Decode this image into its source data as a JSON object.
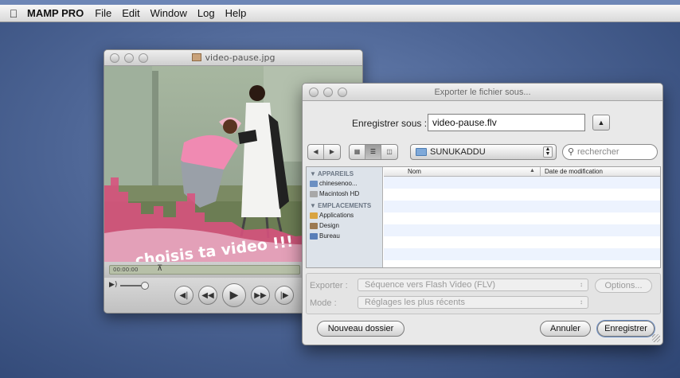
{
  "menubar": {
    "app_name": "MAMP PRO",
    "menus": [
      "File",
      "Edit",
      "Window",
      "Log",
      "Help"
    ]
  },
  "quicktime": {
    "title": "video-pause.jpg",
    "overlay_text": "choisis ta video !!!",
    "timecode": "00:00:00"
  },
  "dialog": {
    "title": "Exporter le fichier sous...",
    "save_as_label": "Enregistrer sous :",
    "filename": "video-pause.flv",
    "folder": "SUNUKADDU",
    "search_placeholder": "rechercher",
    "sidebar": {
      "devices_header": "APPAREILS",
      "devices": [
        "chinesenoo...",
        "Macintosh HD"
      ],
      "places_header": "EMPLACEMENTS",
      "places": [
        "Applications",
        "Design",
        "Bureau"
      ]
    },
    "columns": {
      "name": "Nom",
      "date": "Date de modification"
    },
    "export_label": "Exporter :",
    "export_value": "Séquence vers Flash Video (FLV)",
    "options_label": "Options...",
    "mode_label": "Mode :",
    "mode_value": "Réglages les plus récents",
    "new_folder_label": "Nouveau dossier",
    "cancel_label": "Annuler",
    "save_label": "Enregistrer"
  }
}
